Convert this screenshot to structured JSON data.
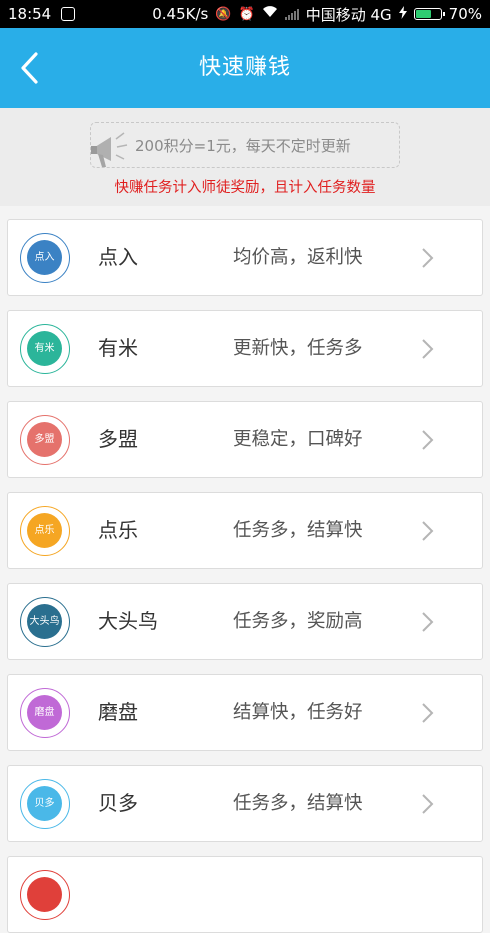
{
  "status_bar": {
    "time": "18:54",
    "speed": "0.45K/s",
    "carrier": "中国移动 4G",
    "battery": "70%",
    "battery_level": 0.7,
    "icons": [
      "app-notification-icon",
      "mute-icon",
      "alarm-icon",
      "wifi-icon",
      "signal-icon",
      "charging-icon",
      "battery-icon"
    ]
  },
  "nav": {
    "title": "快速赚钱",
    "back_icon": "chevron-left-icon"
  },
  "banner": {
    "notice": "200积分=1元，每天不定时更新",
    "notice_icon": "megaphone-icon",
    "reward_note": "快赚任务计入师徒奖励，且计入任务数量"
  },
  "colors": {
    "nav_bg": "#29aee8",
    "reward_text": "#e02020"
  },
  "offers": [
    {
      "logo": "点入",
      "name": "点入",
      "desc": "均价高，返利快",
      "color": "#3b82c4"
    },
    {
      "logo": "有米",
      "name": "有米",
      "desc": "更新快，任务多",
      "color": "#2bb59a"
    },
    {
      "logo": "多盟",
      "name": "多盟",
      "desc": "更稳定，口碑好",
      "color": "#e5726c"
    },
    {
      "logo": "点乐",
      "name": "点乐",
      "desc": "任务多，结算快",
      "color": "#f5a623"
    },
    {
      "logo": "大头鸟",
      "name": "大头鸟",
      "desc": "任务多，奖励高",
      "color": "#2a6f8f"
    },
    {
      "logo": "磨盘",
      "name": "磨盘",
      "desc": "结算快，任务好",
      "color": "#c069d6"
    },
    {
      "logo": "贝多",
      "name": "贝多",
      "desc": "任务多，结算快",
      "color": "#4ab8e8"
    },
    {
      "logo": "",
      "name": "",
      "desc": "",
      "color": "#e0403a"
    }
  ]
}
